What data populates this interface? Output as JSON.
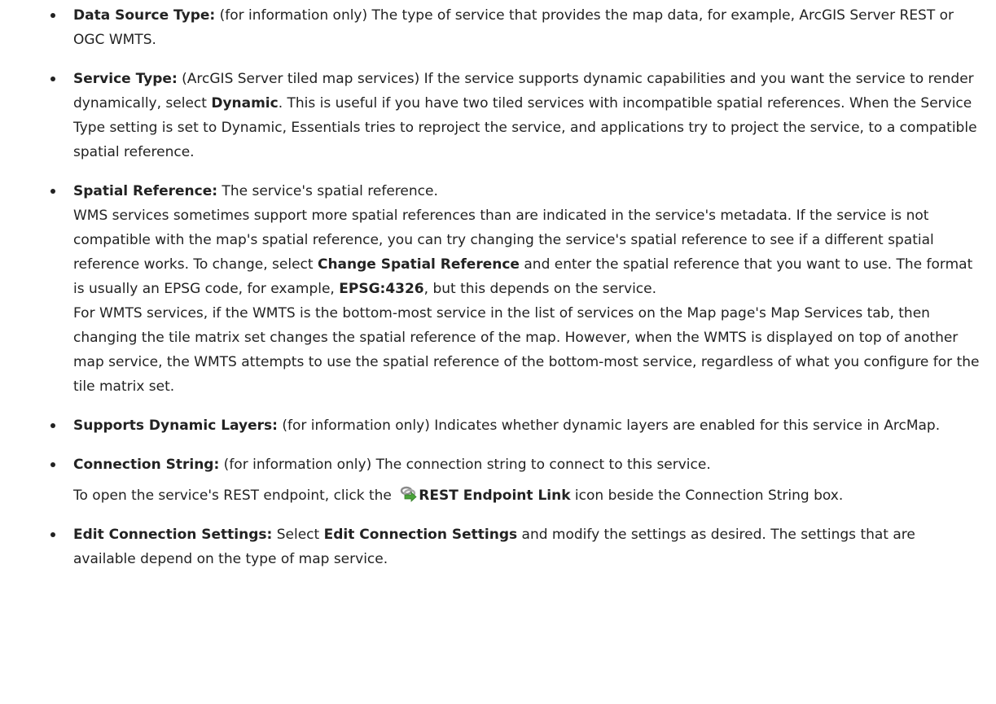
{
  "items": [
    {
      "term": "Data Source Type:",
      "parts": [
        " (for information only) The type of service that provides the map data, for example, ArcGIS Server REST or OGC WMTS."
      ]
    },
    {
      "term": "Service Type:",
      "p1": " (ArcGIS Server tiled map services) If the service supports dynamic capabilities and you want the service to render dynamically, select ",
      "b1": "Dynamic",
      "p2": ". This is useful if you have two tiled services with incompatible spatial references. When the Service Type setting is set to Dynamic, Essentials tries to reproject the service, and applications try to project the service, to a compatible spatial reference."
    },
    {
      "term": "Spatial Reference:",
      "intro": " The service's spatial reference.",
      "wms_p1": "WMS services sometimes support more spatial references than are indicated in the service's metadata. If the service is not compatible with the map's spatial reference, you can try changing the service's spatial reference to see if a different spatial reference works. To change, select ",
      "wms_b1": "Change Spatial Reference",
      "wms_p2": " and enter the spatial reference that you want to use. The format is usually an EPSG code, for example, ",
      "wms_b2": "EPSG:4326",
      "wms_p3": ", but this depends on the service.",
      "wmts": "For WMTS services, if the WMTS is the bottom-most service in the list of services on the Map page's Map Services tab, then changing the tile matrix set changes the spatial reference of the map. However, when the WMTS is displayed on top of another map service, the WMTS attempts to use the spatial reference of the bottom-most service, regardless of what you configure for the tile matrix set."
    },
    {
      "term": "Supports Dynamic Layers:",
      "text": " (for information only) Indicates whether dynamic layers are enabled for this service in ArcMap."
    },
    {
      "term": "Connection String:",
      "text": " (for information only) The connection string to connect to this service.",
      "sub_p1": "To open the service's REST endpoint, click the ",
      "sub_icon": "rest-endpoint-link-icon",
      "sub_b1": "REST Endpoint Link",
      "sub_p2": " icon beside the Connection String box."
    },
    {
      "term": "Edit Connection Settings:",
      "p1": " Select ",
      "b1": "Edit Connection Settings",
      "p2": " and modify the settings as desired. The settings that are available depend on the type of map service."
    }
  ],
  "colors": {
    "text": "#222222",
    "icon_green": "#4aa33a",
    "icon_gray": "#8a8a8a"
  }
}
